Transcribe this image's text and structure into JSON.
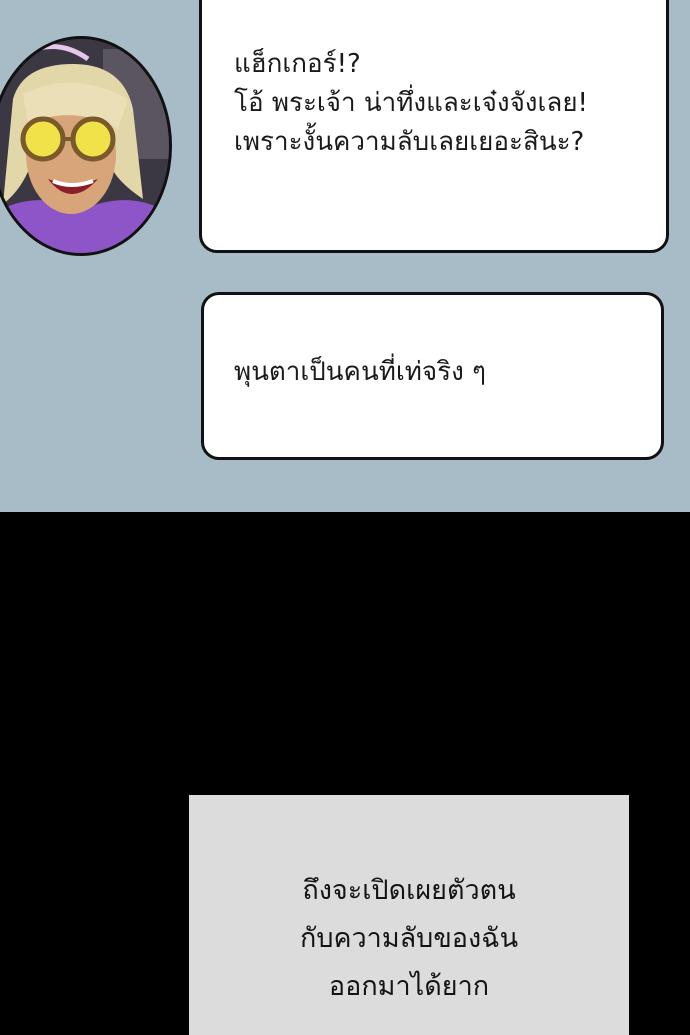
{
  "colors": {
    "panel_background": "#a7bcc7",
    "page_background": "#000000",
    "bubble_fill": "#ffffff",
    "narration_fill": "#dcdcdc"
  },
  "character_portrait": {
    "description_icon": "blonde-woman-with-yellow-sunglasses-avatar"
  },
  "speech_bubble_1": {
    "lines": [
      "แฮ็กเกอร์!?",
      "โอ้ พระเจ้า น่าทึ่งและเจ๋งจังเลย!",
      "เพราะงั้นความลับเลยเยอะสินะ?"
    ]
  },
  "speech_bubble_2": {
    "lines": [
      "พุนตาเป็นคนที่เท่จริง ๆ"
    ]
  },
  "narration_box": {
    "lines": [
      "ถึงจะเปิดเผยตัวตน",
      "กับความลับของฉัน",
      "ออกมาได้ยาก"
    ]
  }
}
